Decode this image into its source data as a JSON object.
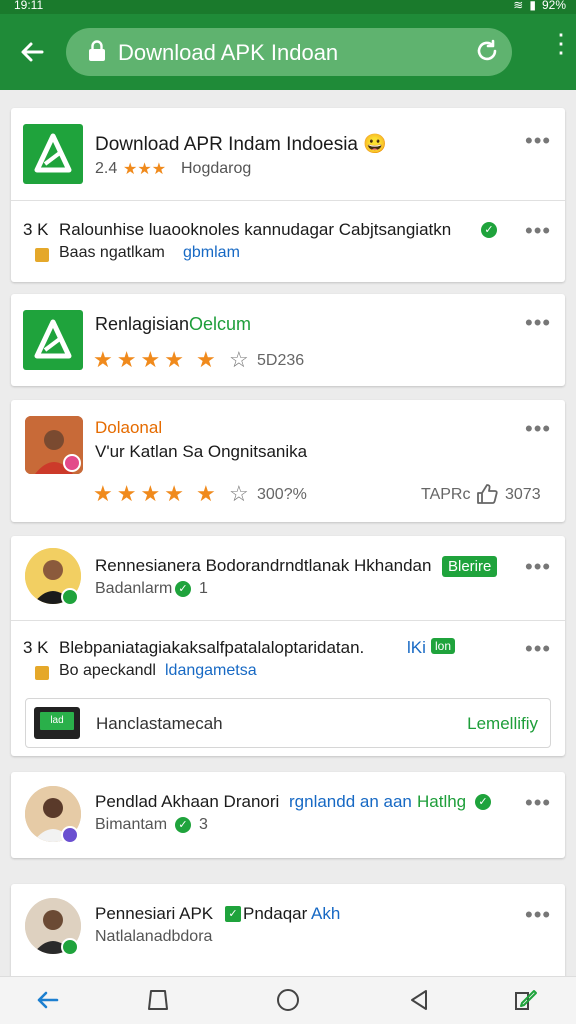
{
  "status_bar": {
    "time": "19:11",
    "battery": "92%"
  },
  "browser": {
    "url_text": "Download APK Indoan"
  },
  "cards": {
    "c1": {
      "title": "Download APR Indam Indoesia 😀",
      "rating_num": "2.4",
      "subtitle": "Hogdarog",
      "post_prefix": "3 K",
      "post_text": "Ralounhise luaooknoles kannudagar Cabjtsangiatkn",
      "post_line2": "Baas ngatlkam",
      "post_line2_link": "gbmlam"
    },
    "c2": {
      "title": "Renlagisian",
      "title_accent": "Oelcum",
      "count": "5D236"
    },
    "c3": {
      "title": "Dolaonal",
      "subtitle": "V'ur Katlan Sa Ongnitsanika",
      "count": "300?%",
      "label_right": "TAPRc",
      "count_right": "3073"
    },
    "c4": {
      "title": "Rennesianera Bodorandrndtlanak Hkhandan",
      "tag": "Blerire",
      "subtitle": "Badanlarm",
      "subtitle_num": "1",
      "post_prefix": "3 K",
      "post_text": "Blebpaniatagiakaksalfpatalaloptaridatan.",
      "post_text_accent": "lKi",
      "post_tag": "lon",
      "post_line2": "Bo apeckandl",
      "post_line2_link": "ldangametsa",
      "promo_text": "Hanclastamecah",
      "promo_link": "Lemellifiy",
      "promo_thumb": "lad"
    },
    "c5": {
      "title": "Pendlad Akhaan Dranori",
      "title_accent": "rgnlandd an aan",
      "title_tag": "Hatlhg",
      "subtitle": "Bimantam",
      "subtitle_num": "3"
    },
    "c6": {
      "title": "Pennesiari APK",
      "title_mid": "Pndaqar",
      "title_accent": "Akh",
      "subtitle": "Natlalanadbdora"
    }
  },
  "colors": {
    "primary_green": "#1f8b38",
    "accent_green": "#1fa33c",
    "star_orange": "#f08a1c",
    "link_blue": "#1769c4"
  },
  "icons": [
    "back-arrow-icon",
    "lock-icon",
    "reload-icon",
    "more-vert-icon",
    "more-horiz-icon",
    "star-icon",
    "thumb-up-icon",
    "nav-back-icon",
    "square-icon",
    "home-circle-icon",
    "triangle-back-icon",
    "edit-icon"
  ]
}
